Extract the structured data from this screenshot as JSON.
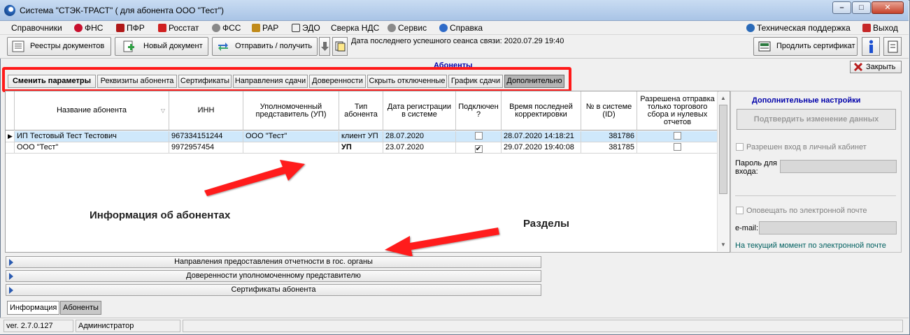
{
  "window": {
    "title": "Система \"СТЭК-ТРАСТ\" ( для абонента ООО \"Тест\")",
    "min": "–",
    "max": "□",
    "close": "✕"
  },
  "menu": {
    "items": [
      "Справочники",
      "ФНС",
      "ПФР",
      "Росстат",
      "ФСС",
      "РАР",
      "ЭДО",
      "Сверка НДС",
      "Сервис",
      "Справка"
    ],
    "support": "Техническая поддержка",
    "exit": "Выход"
  },
  "toolbar": {
    "registry": "Реестры документов",
    "new_doc": "Новый документ",
    "send_receive": "Отправить / получить",
    "last_session": "Дата последнего успешного сеанса связи: 2020.07.29 19:40",
    "extend_cert": "Продлить сертификат"
  },
  "section": {
    "title": "Абоненты",
    "close_btn": "Закрыть"
  },
  "tabs": [
    "Сменить параметры",
    "Реквизиты абонента",
    "Сертификаты",
    "Направления сдачи",
    "Доверенности",
    "Скрыть отключенные",
    "График сдачи",
    "Дополнительно"
  ],
  "table": {
    "headers": [
      "Название абонента",
      "ИНН",
      "Уполномоченный представитель (УП)",
      "Тип абонента",
      "Дата регистрации в системе",
      "Подключен ?",
      "Время последней корректировки",
      "№ в системе (ID)",
      "Разрешена отправка только торгового сбора и нулевых отчетов"
    ],
    "rows": [
      {
        "name": "ИП Тестовый Тест Тестович",
        "inn": "967334151244",
        "up": "ООО \"Тест\"",
        "type": "клиент УП",
        "reg_date": "28.07.2020",
        "connected": false,
        "modified": "28.07.2020 14:18:21",
        "id": "381786",
        "allowed": false,
        "selected": true
      },
      {
        "name": "ООО \"Тест\"",
        "inn": "9972957454",
        "up": "",
        "type": "УП",
        "reg_date": "23.07.2020",
        "connected": true,
        "modified": "29.07.2020 19:40:08",
        "id": "381785",
        "allowed": false,
        "selected": false
      }
    ]
  },
  "panel": {
    "title": "Дополнительные настройки",
    "confirm_btn": "Подтвердить изменение данных",
    "cabinet": "Разрешен вход в личный кабинет",
    "password_label": "Пароль для входа:",
    "notify": "Оповещать по электронной почте",
    "email_label": "e-mail:",
    "now_email": "На текущий момент по электронной почте"
  },
  "annotations": {
    "info": "Информация об абонентах",
    "sections": "Разделы"
  },
  "collapsibles": [
    "Направления предоставления отчетности в гос. органы",
    "Доверенности уполномоченному представителю",
    "Сертификаты абонента"
  ],
  "bottom_tabs": [
    "Информация",
    "Абоненты"
  ],
  "status": {
    "version": "ver. 2.7.0.127",
    "user": "Администратор"
  },
  "colors": {
    "highlight": "#ff1a1a",
    "selected_row": "#cfe8fb",
    "arrow": "#ff1a1a",
    "link": "#0000aa"
  }
}
